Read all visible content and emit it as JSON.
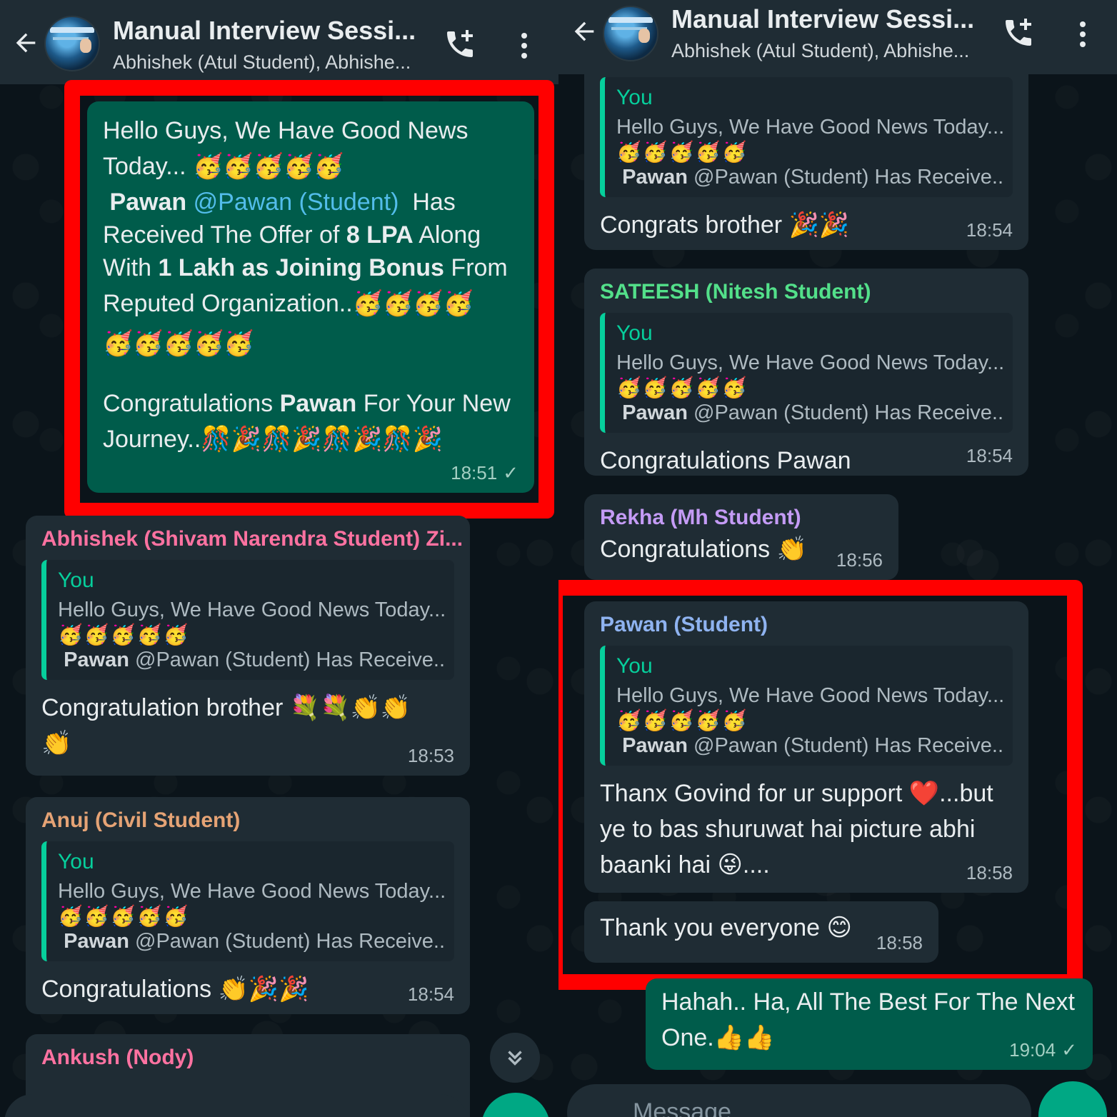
{
  "colors": {
    "accent": "#00a884",
    "highlight": "#ff0000",
    "outgoing": "#005c4b",
    "incoming": "#1f2c34"
  },
  "header": {
    "title": "Manual Interview Sessi...",
    "subtitle": "Abhishek (Atul Student), Abhishe..."
  },
  "left": {
    "announcement": {
      "line1": "Hello Guys, We Have Good News",
      "line2": "Today...",
      "line2_emoji": "🥳🥳🥳🥳🥳",
      "name": "Pawan",
      "mention": "@Pawan (Student)",
      "has": "Has",
      "received_pre": "Received The Offer of",
      "lpa": "8 LPA",
      "along": "Along",
      "with": "With",
      "bonus": "1 Lakh as Joining Bonus",
      "from": "From",
      "reputed": "Reputed Organization..",
      "reputed_emoji": "🥳🥳🥳🥳",
      "emoji_row": "🥳🥳🥳🥳🥳",
      "congrats_pre": "Congratulations",
      "congrats_name": "Pawan",
      "congrats_post": "For Your New",
      "journey": "Journey..",
      "journey_emoji": "🎊🎉🎊🎉🎊🎉🎊🎉",
      "time": "18:51",
      "tick": "✓"
    },
    "messages": [
      {
        "sender": "Abhishek (Shivam Narendra Student) Zi...",
        "sender_color": "#ff72a1",
        "quote_who": "You",
        "quote_line1": "Hello Guys, We Have Good News Today...",
        "quote_emoji": "🥳🥳🥳🥳🥳",
        "quote_bold": "Pawan",
        "quote_rest": "@Pawan (Student)  Has Receive...",
        "text": "Congratulation brother 💐💐👏👏",
        "text2": "👏",
        "time": "18:53"
      },
      {
        "sender": "Anuj (Civil Student)",
        "sender_color": "#e5a375",
        "quote_who": "You",
        "quote_line1": "Hello Guys, We Have Good News Today...",
        "quote_emoji": "🥳🥳🥳🥳🥳",
        "quote_bold": "Pawan",
        "quote_rest": "@Pawan (Student)  Has Receive...",
        "text": "Congratulations 👏🎉🎉",
        "time": "18:54"
      },
      {
        "sender": "Ankush (Nody)",
        "sender_color": "#ff72a1"
      }
    ],
    "scroll_icon": "chevron-double-down"
  },
  "right": {
    "messages": [
      {
        "quote_who": "You",
        "quote_line1": "Hello Guys, We Have Good News Today...",
        "quote_emoji": "🥳🥳🥳🥳🥳",
        "quote_bold": "Pawan",
        "quote_rest": "@Pawan (Student)  Has Receive...",
        "text": "Congrats brother 🎉🎉",
        "time": "18:54"
      },
      {
        "sender": "SATEESH (Nitesh Student)",
        "sender_color": "#53e08a",
        "quote_who": "You",
        "quote_line1": "Hello Guys, We Have Good News Today...",
        "quote_emoji": "🥳🥳🥳🥳🥳",
        "quote_bold": "Pawan",
        "quote_rest": "@Pawan (Student)  Has Receive...",
        "text": "Congratulations Pawan",
        "time": "18:54"
      },
      {
        "sender": "Rekha (Mh Student)",
        "sender_color": "#c49bf5",
        "text": "Congratulations 👏",
        "time": "18:56"
      },
      {
        "sender": "Pawan (Student)",
        "sender_color": "#8fb3f0",
        "quote_who": "You",
        "quote_line1": "Hello Guys, We Have Good News Today...",
        "quote_emoji": "🥳🥳🥳🥳🥳",
        "quote_bold": "Pawan",
        "quote_rest": "@Pawan (Student)  Has Receive...",
        "text_l1": "Thanx Govind for ur support ❤️...but",
        "text_l2": "ye to bas shuruwat hai picture abhi",
        "text_l3": "baanki hai 😜....",
        "time": "18:58"
      },
      {
        "text": "Thank you everyone 😊",
        "time": "18:58"
      },
      {
        "text_l1": "Hahah.. Ha, All The Best For The Next",
        "text_l2": "One.👍👍",
        "time": "19:04",
        "tick": "✓"
      }
    ],
    "composer_placeholder": "Message"
  }
}
